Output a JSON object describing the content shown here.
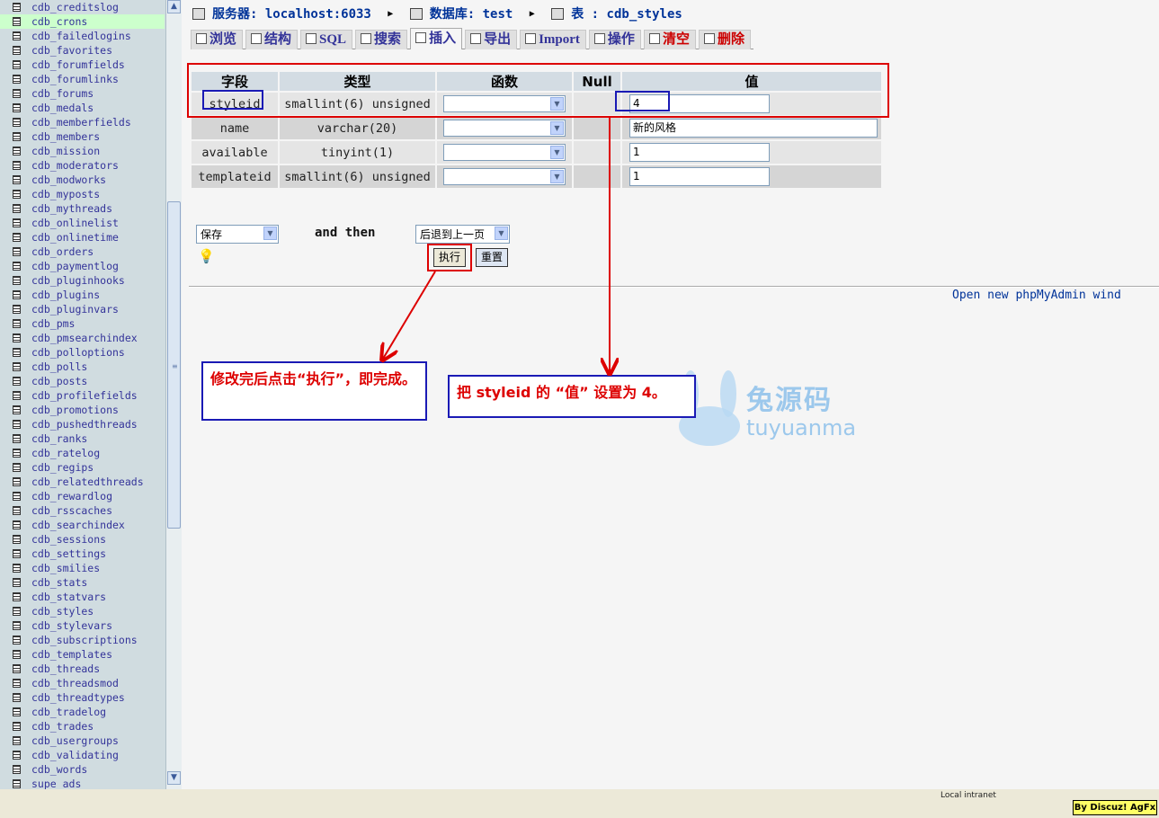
{
  "sidebar": {
    "tables": [
      "cdb_creditslog",
      "cdb_crons",
      "cdb_failedlogins",
      "cdb_favorites",
      "cdb_forumfields",
      "cdb_forumlinks",
      "cdb_forums",
      "cdb_medals",
      "cdb_memberfields",
      "cdb_members",
      "cdb_mission",
      "cdb_moderators",
      "cdb_modworks",
      "cdb_myposts",
      "cdb_mythreads",
      "cdb_onlinelist",
      "cdb_onlinetime",
      "cdb_orders",
      "cdb_paymentlog",
      "cdb_pluginhooks",
      "cdb_plugins",
      "cdb_pluginvars",
      "cdb_pms",
      "cdb_pmsearchindex",
      "cdb_polloptions",
      "cdb_polls",
      "cdb_posts",
      "cdb_profilefields",
      "cdb_promotions",
      "cdb_pushedthreads",
      "cdb_ranks",
      "cdb_ratelog",
      "cdb_regips",
      "cdb_relatedthreads",
      "cdb_rewardlog",
      "cdb_rsscaches",
      "cdb_searchindex",
      "cdb_sessions",
      "cdb_settings",
      "cdb_smilies",
      "cdb_stats",
      "cdb_statvars",
      "cdb_styles",
      "cdb_stylevars",
      "cdb_subscriptions",
      "cdb_templates",
      "cdb_threads",
      "cdb_threadsmod",
      "cdb_threadtypes",
      "cdb_tradelog",
      "cdb_trades",
      "cdb_usergroups",
      "cdb_validating",
      "cdb_words",
      "supe_ads"
    ],
    "highlighted": "cdb_crons"
  },
  "breadcrumb": {
    "server_label": "服务器: localhost:6033",
    "db_label": "数据库: test",
    "table_label": "表 : cdb_styles"
  },
  "tabs": [
    {
      "label": "浏览",
      "icon": "browse-icon"
    },
    {
      "label": "结构",
      "icon": "structure-icon"
    },
    {
      "label": "SQL",
      "icon": "sql-icon"
    },
    {
      "label": "搜索",
      "icon": "search-icon"
    },
    {
      "label": "插入",
      "icon": "insert-icon"
    },
    {
      "label": "导出",
      "icon": "export-icon"
    },
    {
      "label": "Import",
      "icon": "import-icon"
    },
    {
      "label": "操作",
      "icon": "operations-icon"
    },
    {
      "label": "清空",
      "icon": "empty-icon"
    },
    {
      "label": "删除",
      "icon": "drop-icon"
    }
  ],
  "active_tab": "插入",
  "table": {
    "headers": [
      "字段",
      "类型",
      "函数",
      "Null",
      "值"
    ],
    "rows": [
      {
        "field": "styleid",
        "type": "smallint(6) unsigned",
        "value": "4"
      },
      {
        "field": "name",
        "type": "varchar(20)",
        "value": "新的风格"
      },
      {
        "field": "available",
        "type": "tinyint(1)",
        "value": "1"
      },
      {
        "field": "templateid",
        "type": "smallint(6) unsigned",
        "value": "1"
      }
    ]
  },
  "form": {
    "action_select": "保存",
    "and_then": "and then",
    "after_select": "后退到上一页",
    "execute_label": "执行",
    "reset_label": "重置"
  },
  "open_new": "Open new phpMyAdmin wind",
  "annotations": {
    "left_note": "修改完后点击“执行”，即完成。",
    "right_note": "把 styleid 的 “值” 设置为 4。"
  },
  "watermark": {
    "cn": "兔源码",
    "en": "tuyuanma"
  },
  "statusbar": {
    "zone": "Local intranet",
    "badge": "By Discuz! AgFx"
  },
  "colors": {
    "annotation_red": "#dd0000",
    "annotation_blue": "#1a1ab5",
    "link": "#333399",
    "sidebar_bg": "#d0dce0"
  }
}
